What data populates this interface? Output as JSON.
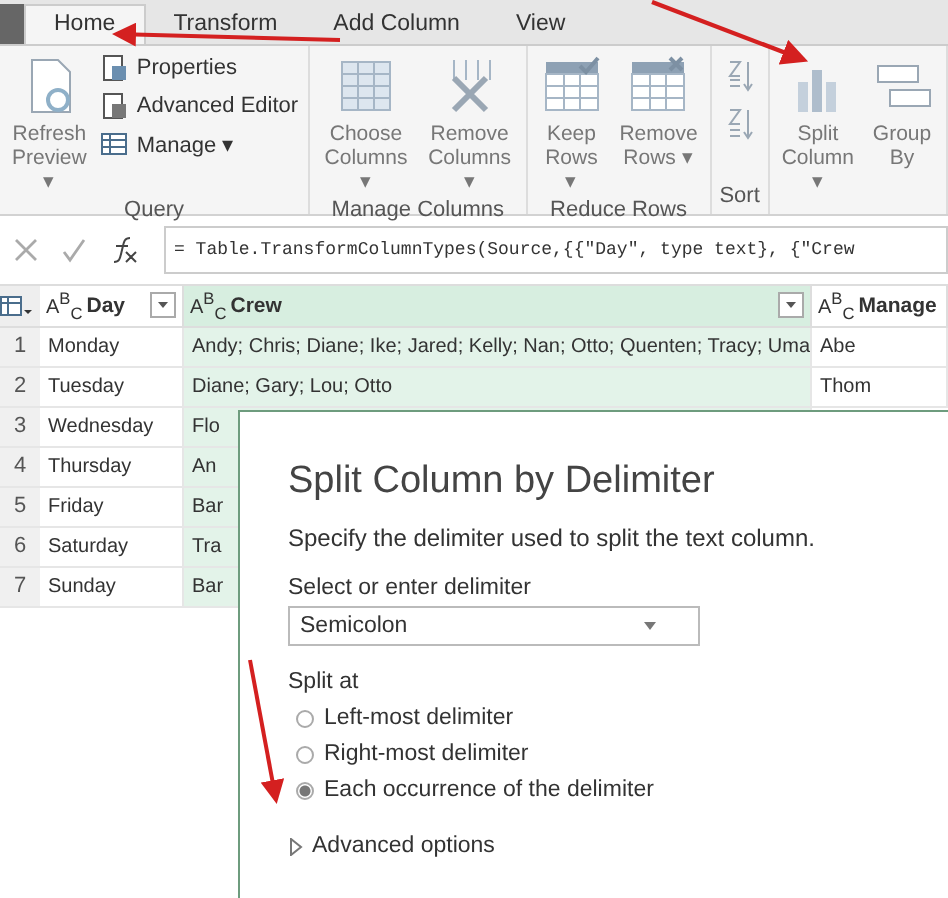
{
  "tabs": [
    {
      "label": "Home",
      "selected": true
    },
    {
      "label": "Transform",
      "selected": false
    },
    {
      "label": "Add Column",
      "selected": false
    },
    {
      "label": "View",
      "selected": false
    }
  ],
  "ribbon": {
    "groups": [
      {
        "label": "Query",
        "items": [
          {
            "kind": "large",
            "lines": [
              "Refresh",
              "Preview ▾"
            ]
          },
          {
            "kind": "stack",
            "entries": [
              {
                "label": "Properties"
              },
              {
                "label": "Advanced Editor"
              },
              {
                "label": "Manage ▾"
              }
            ]
          }
        ]
      },
      {
        "label": "Manage Columns",
        "items": [
          {
            "kind": "large",
            "lines": [
              "Choose",
              "Columns ▾"
            ]
          },
          {
            "kind": "large",
            "lines": [
              "Remove",
              "Columns ▾"
            ]
          }
        ]
      },
      {
        "label": "Reduce Rows",
        "items": [
          {
            "kind": "large",
            "lines": [
              "Keep",
              "Rows ▾"
            ]
          },
          {
            "kind": "large",
            "lines": [
              "Remove",
              "Rows ▾"
            ]
          }
        ]
      },
      {
        "label": "Sort",
        "items": [
          {
            "kind": "sort"
          }
        ]
      },
      {
        "items": [
          {
            "kind": "large",
            "lines": [
              "Split",
              "Column ▾"
            ]
          },
          {
            "kind": "large",
            "lines": [
              "Group",
              "By"
            ]
          }
        ]
      }
    ]
  },
  "formula": "= Table.TransformColumnTypes(Source,{{\"Day\", type text}, {\"Crew",
  "table": {
    "columns": [
      {
        "type_label": "A$^{B}$$_{C}$",
        "name": "Day",
        "selected": false
      },
      {
        "type_label": "A$^{B}$$_{C}$",
        "name": "Crew",
        "selected": true
      },
      {
        "type_label": "A$^{B}$$_{C}$",
        "name": "Manage",
        "selected": false
      }
    ],
    "rows": [
      {
        "number": "1",
        "cells": [
          "Monday",
          "Andy; Chris; Diane; Ike; Jared; Kelly; Nan; Otto; Quenten; Tracy; Uma",
          "Abe"
        ]
      },
      {
        "number": "2",
        "cells": [
          "Tuesday",
          "Diane; Gary; Lou; Otto",
          "Thom"
        ]
      },
      {
        "number": "3",
        "cells": [
          "Wednesday",
          "Flo"
        ]
      },
      {
        "number": "4",
        "cells": [
          "Thursday",
          "An"
        ]
      },
      {
        "number": "5",
        "cells": [
          "Friday",
          "Bar"
        ]
      },
      {
        "number": "6",
        "cells": [
          "Saturday",
          "Tra"
        ]
      },
      {
        "number": "7",
        "cells": [
          "Sunday",
          "Bar"
        ]
      }
    ]
  },
  "dialog": {
    "title": "Split Column by Delimiter",
    "description": "Specify the delimiter used to split the text column.",
    "delimiter_label": "Select or enter delimiter",
    "delimiter": "Semicolon",
    "split_label": "Split at",
    "options": [
      {
        "label": "Left-most delimiter",
        "selected": false
      },
      {
        "label": "Right-most delimiter",
        "selected": false
      },
      {
        "label": "Each occurrence of the delimiter",
        "selected": true
      }
    ],
    "advanced": {
      "label": "Advanced options",
      "expanded": false
    }
  }
}
